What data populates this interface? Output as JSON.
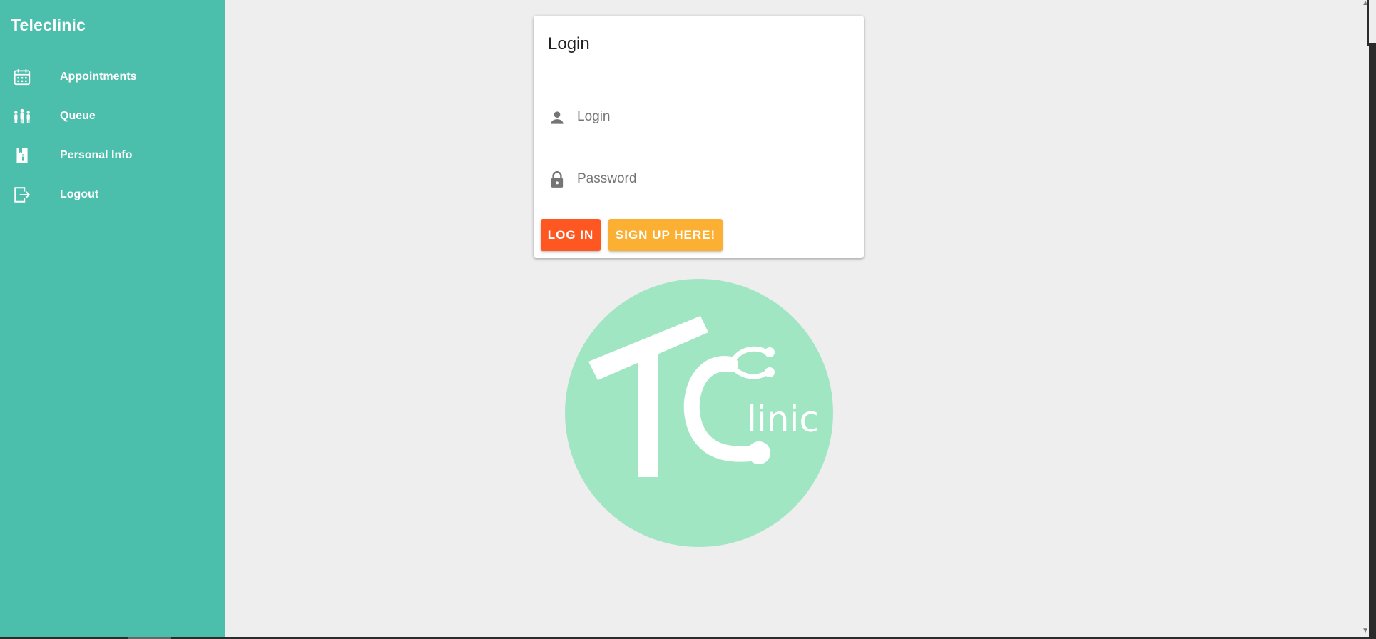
{
  "sidebar": {
    "brand": "Teleclinic",
    "items": [
      {
        "label": "Appointments",
        "icon": "calendar-icon"
      },
      {
        "label": "Queue",
        "icon": "people-queue-icon"
      },
      {
        "label": "Personal Info",
        "icon": "info-book-icon"
      },
      {
        "label": "Logout",
        "icon": "logout-icon"
      }
    ]
  },
  "login_card": {
    "title": "Login",
    "login_field": {
      "placeholder": "Login",
      "value": "",
      "icon": "person-icon"
    },
    "password_field": {
      "placeholder": "Password",
      "value": "",
      "icon": "lock-icon"
    },
    "login_button": "LOG IN",
    "signup_button": "SIGN UP HERE!"
  },
  "logo": {
    "text": "linic"
  },
  "colors": {
    "sidebar_bg": "#4bbeac",
    "page_bg": "#eeeeee",
    "login_button": "#ff5722",
    "signup_button": "#fbb034",
    "logo_circle": "#a0e6c3"
  }
}
